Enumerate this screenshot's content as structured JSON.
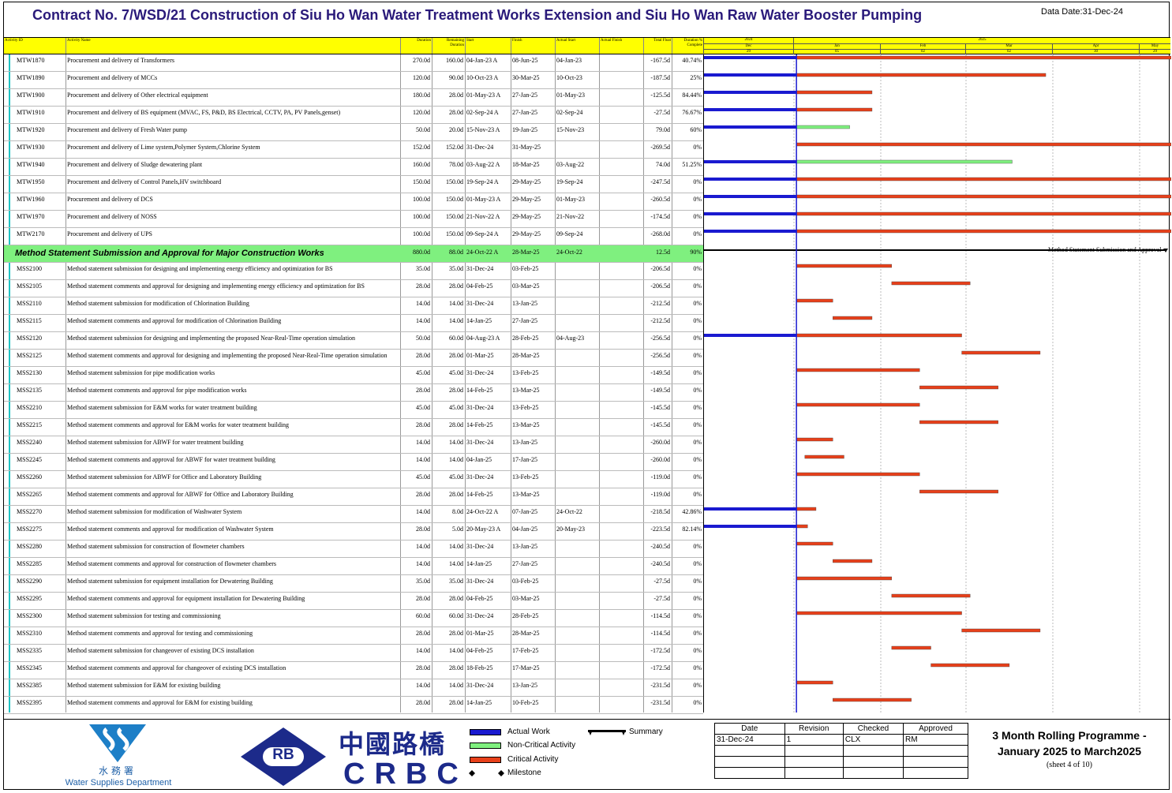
{
  "title": "Contract No. 7/WSD/21 Construction of Siu Ho Wan Water Treatment Works Extension and Siu Ho Wan Raw Water Booster Pumping",
  "data_date": "Data Date:31-Dec-24",
  "headers": {
    "activity_id": "Activity ID",
    "activity_name": "Activity Name",
    "duration": "Duration",
    "remaining": "Remaining Duration",
    "start": "Start",
    "finish": "Finish",
    "actual_start": "Actual Start",
    "actual_finish": "Actual Finish",
    "total_float": "Total Float",
    "pct": "Duration % Complete"
  },
  "timeline": {
    "years": [
      "2024",
      "2025"
    ],
    "months": [
      "Dec",
      "Jan",
      "Feb",
      "Mar",
      "Apr",
      "May"
    ],
    "weeks": [
      "29",
      "05",
      "02",
      "02",
      "30",
      "29"
    ]
  },
  "colors": {
    "actual": "#1a1ad0",
    "noncritical": "#7ff07f",
    "critical": "#e8401a",
    "header": "#ffff00",
    "summary": "#7ff07f"
  },
  "rows": [
    {
      "id": "MTW1870",
      "name": "Procurement and delivery of Transformers",
      "dur": "270.0d",
      "rem": "160.0d",
      "start": "04-Jan-23 A",
      "finish": "08-Jun-25",
      "astart": "04-Jan-23",
      "afinish": "",
      "tf": "-167.5d",
      "pct": "40.74%",
      "actual_to": "2024-12-31",
      "bar_from": "2025-01-01",
      "bar_to": "2025-06-08",
      "crit": true
    },
    {
      "id": "MTW1890",
      "name": "Procurement and delivery of MCCs",
      "dur": "120.0d",
      "rem": "90.0d",
      "start": "10-Oct-23 A",
      "finish": "30-Mar-25",
      "astart": "10-Oct-23",
      "afinish": "",
      "tf": "-187.5d",
      "pct": "25%",
      "actual_to": "2024-12-31",
      "bar_from": "2025-01-01",
      "bar_to": "2025-03-30",
      "crit": true
    },
    {
      "id": "MTW1900",
      "name": "Procurement and delivery of Other electrical equipment",
      "dur": "180.0d",
      "rem": "28.0d",
      "start": "01-May-23 A",
      "finish": "27-Jan-25",
      "astart": "01-May-23",
      "afinish": "",
      "tf": "-125.5d",
      "pct": "84.44%",
      "actual_to": "2024-12-31",
      "bar_from": "2025-01-01",
      "bar_to": "2025-01-27",
      "crit": true
    },
    {
      "id": "MTW1910",
      "name": "Procurement and delivery of BS equipment (MVAC, FS, P&D, BS Electrical, CCTV, PA, PV Panels,genset)",
      "dur": "120.0d",
      "rem": "28.0d",
      "start": "02-Sep-24 A",
      "finish": "27-Jan-25",
      "astart": "02-Sep-24",
      "afinish": "",
      "tf": "-27.5d",
      "pct": "76.67%",
      "actual_to": "2024-12-31",
      "bar_from": "2025-01-01",
      "bar_to": "2025-01-27",
      "crit": true
    },
    {
      "id": "MTW1920",
      "name": "Procurement and delivery of Fresh Water pump",
      "dur": "50.0d",
      "rem": "20.0d",
      "start": "15-Nov-23 A",
      "finish": "19-Jan-25",
      "astart": "15-Nov-23",
      "afinish": "",
      "tf": "79.0d",
      "pct": "60%",
      "actual_to": "2024-12-31",
      "bar_from": "2025-01-01",
      "bar_to": "2025-01-19",
      "crit": false
    },
    {
      "id": "MTW1930",
      "name": "Procurement and delivery of Lime system,Polymer System,Chlorine System",
      "dur": "152.0d",
      "rem": "152.0d",
      "start": "31-Dec-24",
      "finish": "31-May-25",
      "astart": "",
      "afinish": "",
      "tf": "-269.5d",
      "pct": "0%",
      "actual_to": "",
      "bar_from": "2025-01-01",
      "bar_to": "2025-05-31",
      "crit": true
    },
    {
      "id": "MTW1940",
      "name": "Procurement and delivery of Sludge dewatering plant",
      "dur": "160.0d",
      "rem": "78.0d",
      "start": "03-Aug-22 A",
      "finish": "18-Mar-25",
      "astart": "03-Aug-22",
      "afinish": "",
      "tf": "74.0d",
      "pct": "51.25%",
      "actual_to": "2024-12-31",
      "bar_from": "2025-01-01",
      "bar_to": "2025-03-18",
      "crit": false
    },
    {
      "id": "MTW1950",
      "name": "Procurement and delivery of Control Panels,HV switchboard",
      "dur": "150.0d",
      "rem": "150.0d",
      "start": "19-Sep-24 A",
      "finish": "29-May-25",
      "astart": "19-Sep-24",
      "afinish": "",
      "tf": "-247.5d",
      "pct": "0%",
      "actual_to": "2024-12-31",
      "bar_from": "2025-01-01",
      "bar_to": "2025-05-31",
      "crit": true
    },
    {
      "id": "MTW1960",
      "name": "Procurement and delivery of DCS",
      "dur": "100.0d",
      "rem": "150.0d",
      "start": "01-May-23 A",
      "finish": "29-May-25",
      "astart": "01-May-23",
      "afinish": "",
      "tf": "-260.5d",
      "pct": "0%",
      "actual_to": "2024-12-31",
      "bar_from": "2025-01-01",
      "bar_to": "2025-05-31",
      "crit": true
    },
    {
      "id": "MTW1970",
      "name": "Procurement and delivery of NOSS",
      "dur": "100.0d",
      "rem": "150.0d",
      "start": "21-Nov-22 A",
      "finish": "29-May-25",
      "astart": "21-Nov-22",
      "afinish": "",
      "tf": "-174.5d",
      "pct": "0%",
      "actual_to": "2024-12-31",
      "bar_from": "2025-01-01",
      "bar_to": "2025-05-31",
      "crit": true
    },
    {
      "id": "MTW2170",
      "name": "Procurement and delivery of UPS",
      "dur": "100.0d",
      "rem": "150.0d",
      "start": "09-Sep-24 A",
      "finish": "29-May-25",
      "astart": "09-Sep-24",
      "afinish": "",
      "tf": "-268.0d",
      "pct": "0%",
      "actual_to": "2024-12-31",
      "bar_from": "2025-01-01",
      "bar_to": "2025-05-31",
      "crit": true
    },
    {
      "summary": true,
      "id": "",
      "name": "Method Statement Submission and Approval for Major Construction Works",
      "dur": "880.0d",
      "rem": "88.0d",
      "start": "24-Oct-22 A",
      "finish": "28-Mar-25",
      "astart": "24-Oct-22",
      "afinish": "",
      "tf": "12.5d",
      "pct": "90%",
      "label": "Method Statement Submission and Approval"
    },
    {
      "id": "MSS2100",
      "name": "Method statement submission for designing and implementing energy efficiency and optimization for BS",
      "dur": "35.0d",
      "rem": "35.0d",
      "start": "31-Dec-24",
      "finish": "03-Feb-25",
      "astart": "",
      "afinish": "",
      "tf": "-206.5d",
      "pct": "0%",
      "actual_to": "",
      "bar_from": "2025-01-01",
      "bar_to": "2025-02-03",
      "crit": true
    },
    {
      "id": "MSS2105",
      "name": "Method statement comments and approval for designing and implementing energy efficiency and optimization for BS",
      "dur": "28.0d",
      "rem": "28.0d",
      "start": "04-Feb-25",
      "finish": "03-Mar-25",
      "astart": "",
      "afinish": "",
      "tf": "-206.5d",
      "pct": "0%",
      "actual_to": "",
      "bar_from": "2025-02-04",
      "bar_to": "2025-03-03",
      "crit": true
    },
    {
      "id": "MSS2110",
      "name": "Method statement submission for modification of Chlorination Building",
      "dur": "14.0d",
      "rem": "14.0d",
      "start": "31-Dec-24",
      "finish": "13-Jan-25",
      "astart": "",
      "afinish": "",
      "tf": "-212.5d",
      "pct": "0%",
      "actual_to": "",
      "bar_from": "2025-01-01",
      "bar_to": "2025-01-13",
      "crit": true
    },
    {
      "id": "MSS2115",
      "name": "Method statement  comments and approval for modification of Chlorination Building",
      "dur": "14.0d",
      "rem": "14.0d",
      "start": "14-Jan-25",
      "finish": "27-Jan-25",
      "astart": "",
      "afinish": "",
      "tf": "-212.5d",
      "pct": "0%",
      "actual_to": "",
      "bar_from": "2025-01-14",
      "bar_to": "2025-01-27",
      "crit": true
    },
    {
      "id": "MSS2120",
      "name": "Method statement submission for designing and implementing the proposed Near-Real-Time operation simulation",
      "dur": "50.0d",
      "rem": "60.0d",
      "start": "04-Aug-23 A",
      "finish": "28-Feb-25",
      "astart": "04-Aug-23",
      "afinish": "",
      "tf": "-256.5d",
      "pct": "0%",
      "actual_to": "2024-12-31",
      "bar_from": "2025-01-01",
      "bar_to": "2025-02-28",
      "crit": true
    },
    {
      "id": "MSS2125",
      "name": "Method statement comments and approval for designing and implementing the proposed Near-Real-Time operation simulation",
      "dur": "28.0d",
      "rem": "28.0d",
      "start": "01-Mar-25",
      "finish": "28-Mar-25",
      "astart": "",
      "afinish": "",
      "tf": "-256.5d",
      "pct": "0%",
      "actual_to": "",
      "bar_from": "2025-03-01",
      "bar_to": "2025-03-28",
      "crit": true
    },
    {
      "id": "MSS2130",
      "name": "Method statement submission for pipe modification works",
      "dur": "45.0d",
      "rem": "45.0d",
      "start": "31-Dec-24",
      "finish": "13-Feb-25",
      "astart": "",
      "afinish": "",
      "tf": "-149.5d",
      "pct": "0%",
      "actual_to": "",
      "bar_from": "2025-01-01",
      "bar_to": "2025-02-13",
      "crit": true
    },
    {
      "id": "MSS2135",
      "name": "Method statement comments and approval for pipe modification works",
      "dur": "28.0d",
      "rem": "28.0d",
      "start": "14-Feb-25",
      "finish": "13-Mar-25",
      "astart": "",
      "afinish": "",
      "tf": "-149.5d",
      "pct": "0%",
      "actual_to": "",
      "bar_from": "2025-02-14",
      "bar_to": "2025-03-13",
      "crit": true
    },
    {
      "id": "MSS2210",
      "name": "Method statement submission for E&M works for water treatment building",
      "dur": "45.0d",
      "rem": "45.0d",
      "start": "31-Dec-24",
      "finish": "13-Feb-25",
      "astart": "",
      "afinish": "",
      "tf": "-145.5d",
      "pct": "0%",
      "actual_to": "",
      "bar_from": "2025-01-01",
      "bar_to": "2025-02-13",
      "crit": true
    },
    {
      "id": "MSS2215",
      "name": "Method statement comments and approval for E&M works for water treatment building",
      "dur": "28.0d",
      "rem": "28.0d",
      "start": "14-Feb-25",
      "finish": "13-Mar-25",
      "astart": "",
      "afinish": "",
      "tf": "-145.5d",
      "pct": "0%",
      "actual_to": "",
      "bar_from": "2025-02-14",
      "bar_to": "2025-03-13",
      "crit": true
    },
    {
      "id": "MSS2240",
      "name": "Method statement submission for ABWF for water treatment building",
      "dur": "14.0d",
      "rem": "14.0d",
      "start": "31-Dec-24",
      "finish": "13-Jan-25",
      "astart": "",
      "afinish": "",
      "tf": "-260.0d",
      "pct": "0%",
      "actual_to": "",
      "bar_from": "2025-01-01",
      "bar_to": "2025-01-13",
      "crit": true
    },
    {
      "id": "MSS2245",
      "name": "Method statement comments and approval for ABWF for water treatment building",
      "dur": "14.0d",
      "rem": "14.0d",
      "start": "04-Jan-25",
      "finish": "17-Jan-25",
      "astart": "",
      "afinish": "",
      "tf": "-260.0d",
      "pct": "0%",
      "actual_to": "",
      "bar_from": "2025-01-04",
      "bar_to": "2025-01-17",
      "crit": true
    },
    {
      "id": "MSS2260",
      "name": "Method statement submission for ABWF for Office and Laboratory Building",
      "dur": "45.0d",
      "rem": "45.0d",
      "start": "31-Dec-24",
      "finish": "13-Feb-25",
      "astart": "",
      "afinish": "",
      "tf": "-119.0d",
      "pct": "0%",
      "actual_to": "",
      "bar_from": "2025-01-01",
      "bar_to": "2025-02-13",
      "crit": true
    },
    {
      "id": "MSS2265",
      "name": "Method statement comments and approval for ABWF for Office and Laboratory Building",
      "dur": "28.0d",
      "rem": "28.0d",
      "start": "14-Feb-25",
      "finish": "13-Mar-25",
      "astart": "",
      "afinish": "",
      "tf": "-119.0d",
      "pct": "0%",
      "actual_to": "",
      "bar_from": "2025-02-14",
      "bar_to": "2025-03-13",
      "crit": true
    },
    {
      "id": "MSS2270",
      "name": "Method statement submission for modification of Washwater System",
      "dur": "14.0d",
      "rem": "8.0d",
      "start": "24-Oct-22 A",
      "finish": "07-Jan-25",
      "astart": "24-Oct-22",
      "afinish": "",
      "tf": "-218.5d",
      "pct": "42.86%",
      "actual_to": "2024-12-31",
      "bar_from": "2025-01-01",
      "bar_to": "2025-01-07",
      "crit": true
    },
    {
      "id": "MSS2275",
      "name": "Method statement comments and approval for modification of Washwater System",
      "dur": "28.0d",
      "rem": "5.0d",
      "start": "20-May-23 A",
      "finish": "04-Jan-25",
      "astart": "20-May-23",
      "afinish": "",
      "tf": "-223.5d",
      "pct": "82.14%",
      "actual_to": "2024-12-31",
      "bar_from": "2025-01-01",
      "bar_to": "2025-01-04",
      "crit": true
    },
    {
      "id": "MSS2280",
      "name": "Method statement submission for construction of flowmeter chambers",
      "dur": "14.0d",
      "rem": "14.0d",
      "start": "31-Dec-24",
      "finish": "13-Jan-25",
      "astart": "",
      "afinish": "",
      "tf": "-240.5d",
      "pct": "0%",
      "actual_to": "",
      "bar_from": "2025-01-01",
      "bar_to": "2025-01-13",
      "crit": true
    },
    {
      "id": "MSS2285",
      "name": "Method statement comments and approval for construction of flowmeter chambers",
      "dur": "14.0d",
      "rem": "14.0d",
      "start": "14-Jan-25",
      "finish": "27-Jan-25",
      "astart": "",
      "afinish": "",
      "tf": "-240.5d",
      "pct": "0%",
      "actual_to": "",
      "bar_from": "2025-01-14",
      "bar_to": "2025-01-27",
      "crit": true
    },
    {
      "id": "MSS2290",
      "name": "Method statement submission for equipment installation for Dewatering Building",
      "dur": "35.0d",
      "rem": "35.0d",
      "start": "31-Dec-24",
      "finish": "03-Feb-25",
      "astart": "",
      "afinish": "",
      "tf": "-27.5d",
      "pct": "0%",
      "actual_to": "",
      "bar_from": "2025-01-01",
      "bar_to": "2025-02-03",
      "crit": true
    },
    {
      "id": "MSS2295",
      "name": "Method statement comments and approval for equipment installation for Dewatering Building",
      "dur": "28.0d",
      "rem": "28.0d",
      "start": "04-Feb-25",
      "finish": "03-Mar-25",
      "astart": "",
      "afinish": "",
      "tf": "-27.5d",
      "pct": "0%",
      "actual_to": "",
      "bar_from": "2025-02-04",
      "bar_to": "2025-03-03",
      "crit": true
    },
    {
      "id": "MSS2300",
      "name": "Method statement submission for testing and commissioning",
      "dur": "60.0d",
      "rem": "60.0d",
      "start": "31-Dec-24",
      "finish": "28-Feb-25",
      "astart": "",
      "afinish": "",
      "tf": "-114.5d",
      "pct": "0%",
      "actual_to": "",
      "bar_from": "2025-01-01",
      "bar_to": "2025-02-28",
      "crit": true
    },
    {
      "id": "MSS2310",
      "name": "Method statement comments and approval for testing and commissioning",
      "dur": "28.0d",
      "rem": "28.0d",
      "start": "01-Mar-25",
      "finish": "28-Mar-25",
      "astart": "",
      "afinish": "",
      "tf": "-114.5d",
      "pct": "0%",
      "actual_to": "",
      "bar_from": "2025-03-01",
      "bar_to": "2025-03-28",
      "crit": true
    },
    {
      "id": "MSS2335",
      "name": "Method statement submission for changeover of existing DCS installation",
      "dur": "14.0d",
      "rem": "14.0d",
      "start": "04-Feb-25",
      "finish": "17-Feb-25",
      "astart": "",
      "afinish": "",
      "tf": "-172.5d",
      "pct": "0%",
      "actual_to": "",
      "bar_from": "2025-02-04",
      "bar_to": "2025-02-17",
      "crit": true
    },
    {
      "id": "MSS2345",
      "name": "Method statement comments and approval for changeover of existing DCS installation",
      "dur": "28.0d",
      "rem": "28.0d",
      "start": "18-Feb-25",
      "finish": "17-Mar-25",
      "astart": "",
      "afinish": "",
      "tf": "-172.5d",
      "pct": "0%",
      "actual_to": "",
      "bar_from": "2025-02-18",
      "bar_to": "2025-03-17",
      "crit": true
    },
    {
      "id": "MSS2385",
      "name": "Method statement submission for E&M for existing building",
      "dur": "14.0d",
      "rem": "14.0d",
      "start": "31-Dec-24",
      "finish": "13-Jan-25",
      "astart": "",
      "afinish": "",
      "tf": "-231.5d",
      "pct": "0%",
      "actual_to": "",
      "bar_from": "2025-01-01",
      "bar_to": "2025-01-13",
      "crit": true
    },
    {
      "id": "MSS2395",
      "name": "Method statement comments and approval for E&M for existing building",
      "dur": "28.0d",
      "rem": "28.0d",
      "start": "14-Jan-25",
      "finish": "10-Feb-25",
      "astart": "",
      "afinish": "",
      "tf": "-231.5d",
      "pct": "0%",
      "actual_to": "",
      "bar_from": "2025-01-14",
      "bar_to": "2025-02-10",
      "crit": true
    }
  ],
  "footer": {
    "wsd_cn": "水務署",
    "wsd_en": "Water Supplies Department",
    "rb": "RB",
    "crbc_cn": "中國路橋",
    "crbc_en": "CRBC",
    "legend": {
      "actual": "Actual Work",
      "noncritical": "Non-Critical Activity",
      "critical": "Critical Activity",
      "milestone": "Milestone",
      "summary": "Summary"
    },
    "rev_headers": [
      "Date",
      "Revision",
      "Checked",
      "Approved"
    ],
    "rev_row": [
      "31-Dec-24",
      "1",
      "CLX",
      "RM"
    ],
    "title_line1": "3 Month Rolling Programme -",
    "title_line2": "January 2025 to March2025",
    "sheet": "(sheet 4 of 10)"
  }
}
